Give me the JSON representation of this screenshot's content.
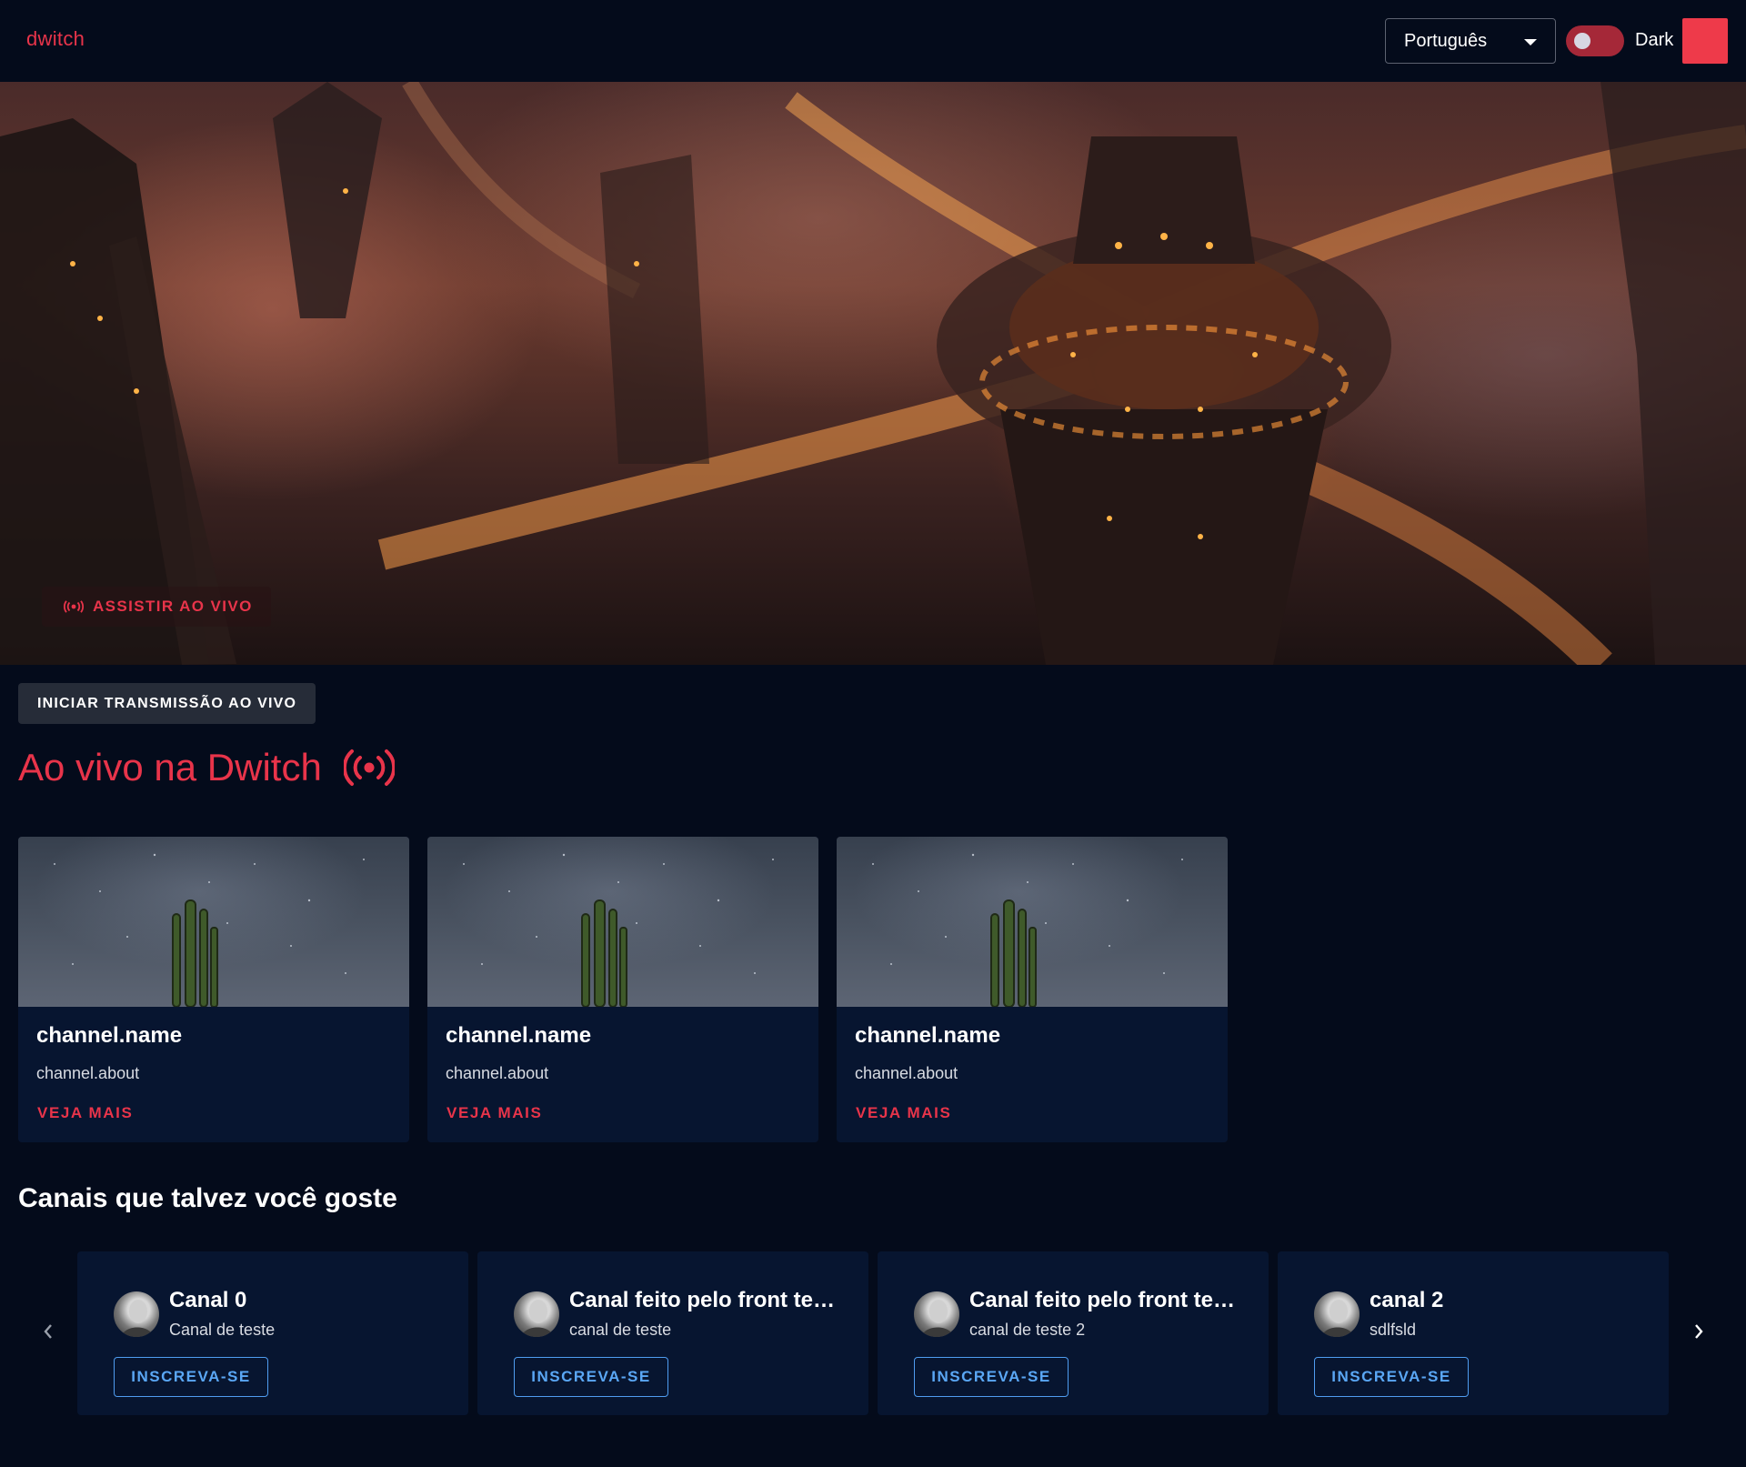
{
  "header": {
    "logo": "dwitch",
    "language": {
      "selected": "Português"
    },
    "theme_toggle": {
      "label": "Dark",
      "on": true
    },
    "accent_color": "#e8344a"
  },
  "hero": {
    "watch_live_label": "ASSISTIR AO VIVO"
  },
  "actions": {
    "start_stream_label": "INICIAR TRANSMISSÃO AO VIVO"
  },
  "live_section": {
    "title": "Ao vivo na Dwitch",
    "cards": [
      {
        "name": "channel.name",
        "about": "channel.about",
        "more_label": "VEJA MAIS"
      },
      {
        "name": "channel.name",
        "about": "channel.about",
        "more_label": "VEJA MAIS"
      },
      {
        "name": "channel.name",
        "about": "channel.about",
        "more_label": "VEJA MAIS"
      }
    ]
  },
  "recommended": {
    "title": "Canais que talvez você goste",
    "channels": [
      {
        "name": "Canal 0",
        "description": "Canal de teste",
        "subscribe_label": "INSCREVA-SE"
      },
      {
        "name": "Canal feito pelo front teste",
        "description": "canal de teste",
        "subscribe_label": "INSCREVA-SE"
      },
      {
        "name": "Canal feito pelo front teste",
        "description": "canal de teste 2",
        "subscribe_label": "INSCREVA-SE"
      },
      {
        "name": "canal 2",
        "description": "sdlfsld",
        "subscribe_label": "INSCREVA-SE"
      }
    ],
    "prev_icon": "chevron-left-icon",
    "next_icon": "chevron-right-icon"
  }
}
